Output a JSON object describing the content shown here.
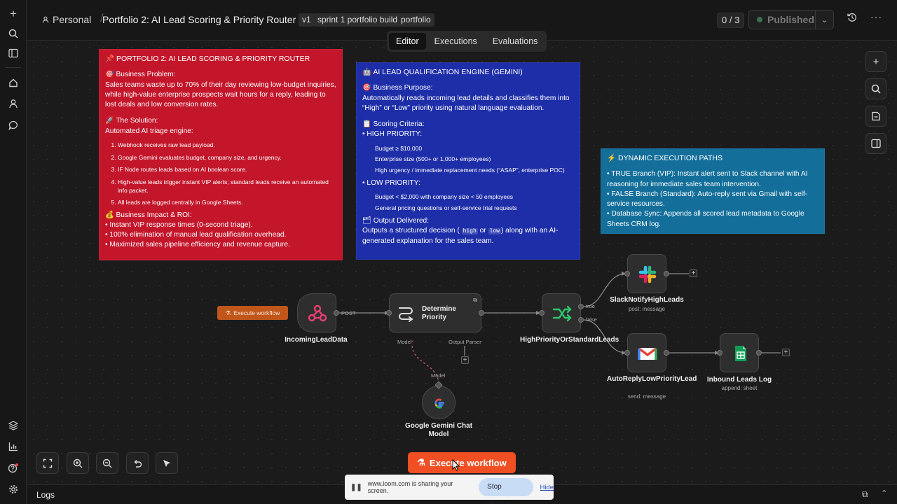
{
  "topbar": {
    "project": "Personal",
    "workflow_title": "Portfolio 2: AI Lead Scoring & Priority Router",
    "tags": [
      "v1",
      "sprint 1 portfolio build",
      "portfolio"
    ],
    "counter": "0 / 3",
    "publish_label": "Published"
  },
  "tabs": [
    "Editor",
    "Executions",
    "Evaluations"
  ],
  "notes": {
    "red": {
      "title": "📌 PORTFOLIO 2: AI LEAD SCORING & PRIORITY ROUTER",
      "problem_h": "🎯 Business Problem:",
      "problem": "Sales teams waste up to 70% of their day reviewing low-budget inquiries, while high-value enterprise prospects wait hours for a reply, leading to lost deals and low conversion rates.",
      "solution_h": "🚀 The Solution:",
      "solution": "Automated AI triage engine:",
      "steps": [
        "Webhook receives raw lead payload.",
        "Google Gemini evaluates budget, company size, and urgency.",
        "IF Node routes leads based on AI boolean score.",
        "High-value leads trigger instant VIP alerts; standard leads receive an automated info packet.",
        "All leads are logged centrally in Google Sheets."
      ],
      "impact_h": "💰 Business Impact & ROI:",
      "impact": [
        "• Instant VIP response times (0-second triage).",
        "• 100% elimination of manual lead qualification overhead.",
        "• Maximized sales pipeline efficiency and revenue capture."
      ]
    },
    "blue": {
      "title": "🤖 AI LEAD QUALIFICATION ENGINE (GEMINI)",
      "purpose_h": "🎯 Business Purpose:",
      "purpose": "Automatically reads incoming lead details and classifies them into “High” or “Low” priority using natural language evaluation.",
      "criteria_h": "📋 Scoring Criteria:",
      "high_h": "• HIGH PRIORITY:",
      "high": [
        "Budget ≥ $10,000",
        "Enterprise size (500+ or 1,000+ employees)",
        "High urgency / immediate replacement needs (“ASAP”, enterprise POC)"
      ],
      "low_h": "• LOW PRIORITY:",
      "low": [
        "Budget < $2,000 with company size < 50 employees",
        "General pricing questions or self-service trial requests"
      ],
      "output_h": "🗂 Output Delivered:",
      "output_a": "Outputs a structured decision (",
      "code_high": "high",
      "output_or": "or",
      "code_low": "low",
      "output_b": ") along with an AI-generated explanation for the sales team."
    },
    "teal": {
      "title": "⚡ DYNAMIC EXECUTION PATHS",
      "lines": [
        "• TRUE Branch (VIP): Instant alert sent to Slack channel with AI reasoning for immediate sales team intervention.",
        "• FALSE Branch (Standard): Auto-reply sent via Gmail with self-service resources.",
        "• Database Sync: Appends all scored lead metadata to Google Sheets CRM log."
      ]
    }
  },
  "nodes": {
    "webhook": {
      "label": "IncomingLeadData",
      "port": "POST"
    },
    "agent": {
      "label": "Determine Priority",
      "model_port": "Model",
      "parser_port": "Output Parser"
    },
    "if": {
      "label": "HighPriorityOrStandardLeads",
      "true_label": "true",
      "false_label": "false"
    },
    "slack": {
      "label": "SlackNotifyHighLeads",
      "sub": "post: message"
    },
    "gmail": {
      "label": "AutoReplyLowPriorityLead",
      "sub": "send: message"
    },
    "sheets": {
      "label": "Inbound Leads Log",
      "sub": "append: sheet"
    },
    "gemini": {
      "label": "Google Gemini Chat Model",
      "port": "Model"
    }
  },
  "buttons": {
    "execute_mini": "Execute workflow",
    "execute_main": "Execute workflow"
  },
  "logs": "Logs",
  "loom": {
    "message": "www.loom.com is sharing your screen.",
    "stop": "Stop sharing",
    "hide": "Hide"
  },
  "colors": {
    "accent": "#f04e23",
    "note_red": "#c3162b",
    "note_blue": "#1e2ea8",
    "note_teal": "#136e9a"
  }
}
